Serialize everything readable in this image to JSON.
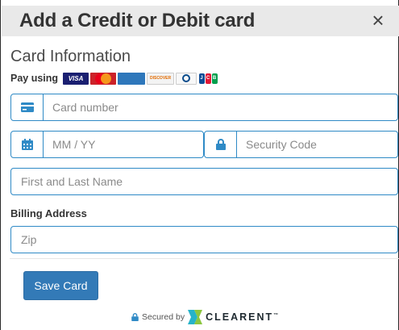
{
  "dialog": {
    "title": "Add a Credit or Debit card",
    "close_label": "×"
  },
  "form": {
    "section_title": "Card Information",
    "pay_using_label": "Pay using",
    "accepted_cards": [
      "VISA",
      "MasterCard",
      "AMERICAN EXPRESS",
      "DISCOVER",
      "Diners Club",
      "JCB"
    ],
    "card_number": {
      "placeholder": "Card number",
      "value": ""
    },
    "expiry": {
      "placeholder": "MM / YY",
      "value": ""
    },
    "security_code": {
      "placeholder": "Security Code",
      "value": ""
    },
    "name": {
      "placeholder": "First and Last Name",
      "value": ""
    },
    "billing_label": "Billing Address",
    "zip": {
      "placeholder": "Zip",
      "value": ""
    },
    "save_button": "Save Card"
  },
  "footer": {
    "secured_by": "Secured by",
    "brand": "CLEARENT",
    "trademark": "™"
  },
  "colors": {
    "accent": "#2f8ac6",
    "button": "#337ab7",
    "header_bg": "#e9e9e9"
  }
}
